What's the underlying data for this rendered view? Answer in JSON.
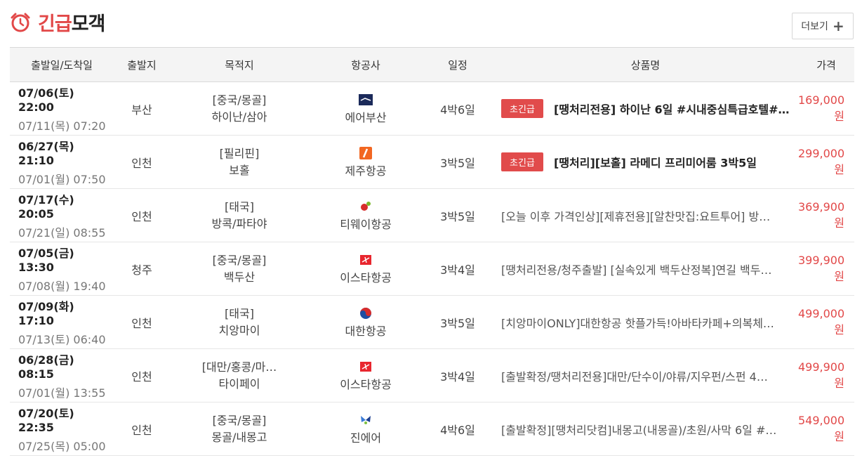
{
  "header": {
    "title_red": "긴급",
    "title_black": "모객",
    "more_label": "더보기",
    "accent_color": "#e24848"
  },
  "table": {
    "columns": [
      "출발일/도착일",
      "출발지",
      "목적지",
      "항공사",
      "일정",
      "상품명",
      "가격"
    ],
    "rows": [
      {
        "depart": "07/06(토) 22:00",
        "arrive": "07/11(목) 07:20",
        "origin": "부산",
        "dest_region": "[중국/몽골]",
        "dest_city": "하이난/삼아",
        "airline": "에어부산",
        "airline_icon": "air-busan-logo-icon",
        "schedule": "4박6일",
        "badge": "초긴급",
        "product": "[땡처리전용] 하이난 6일 #시내중심특급호텔#…",
        "price": "169,000원"
      },
      {
        "depart": "06/27(목) 21:10",
        "arrive": "07/01(월) 07:50",
        "origin": "인천",
        "dest_region": "[필리핀]",
        "dest_city": "보홀",
        "airline": "제주항공",
        "airline_icon": "jeju-air-logo-icon",
        "schedule": "3박5일",
        "badge": "초긴급",
        "product": "[땡처리][보홀] 라메디 프리미어룸 3박5일",
        "price": "299,000원"
      },
      {
        "depart": "07/17(수) 20:05",
        "arrive": "07/21(일) 08:55",
        "origin": "인천",
        "dest_region": "[태국]",
        "dest_city": "방콕/파타야",
        "airline": "티웨이항공",
        "airline_icon": "tway-logo-icon",
        "schedule": "3박5일",
        "badge": "",
        "product": "[오늘 이후 가격인상][제휴전용][알찬맛집:요트투어] 방…",
        "price": "369,900원"
      },
      {
        "depart": "07/05(금) 13:30",
        "arrive": "07/08(월) 19:40",
        "origin": "청주",
        "dest_region": "[중국/몽골]",
        "dest_city": "백두산",
        "airline": "이스타항공",
        "airline_icon": "eastar-jet-logo-icon",
        "schedule": "3박4일",
        "badge": "",
        "product": "[땡처리전용/청주출발] [실속있게 백두산정복]연길 백두…",
        "price": "399,900원"
      },
      {
        "depart": "07/09(화) 17:10",
        "arrive": "07/13(토) 06:40",
        "origin": "인천",
        "dest_region": "[태국]",
        "dest_city": "치앙마이",
        "airline": "대한항공",
        "airline_icon": "korean-air-logo-icon",
        "schedule": "3박5일",
        "badge": "",
        "product": "[치앙마이ONLY]대한항공 핫플가득!아바타카페+의복체…",
        "price": "499,000원"
      },
      {
        "depart": "06/28(금) 08:15",
        "arrive": "07/01(월) 13:55",
        "origin": "인천",
        "dest_region": "[대만/홍콩/마…",
        "dest_city": "타이페이",
        "airline": "이스타항공",
        "airline_icon": "eastar-jet-logo-icon",
        "schedule": "3박4일",
        "badge": "",
        "product": "[출발확정/땡처리전용]대만/단수이/야류/지우펀/스펀 4…",
        "price": "499,900원"
      },
      {
        "depart": "07/20(토) 22:35",
        "arrive": "07/25(목) 05:00",
        "origin": "인천",
        "dest_region": "[중국/몽골]",
        "dest_city": "몽골/내몽고",
        "airline": "진에어",
        "airline_icon": "jin-air-logo-icon",
        "schedule": "4박6일",
        "badge": "",
        "product": "[출발확정][땡처리닷컴]내몽고(내몽골)/초원/사막 6일 #…",
        "price": "549,000원"
      }
    ]
  }
}
